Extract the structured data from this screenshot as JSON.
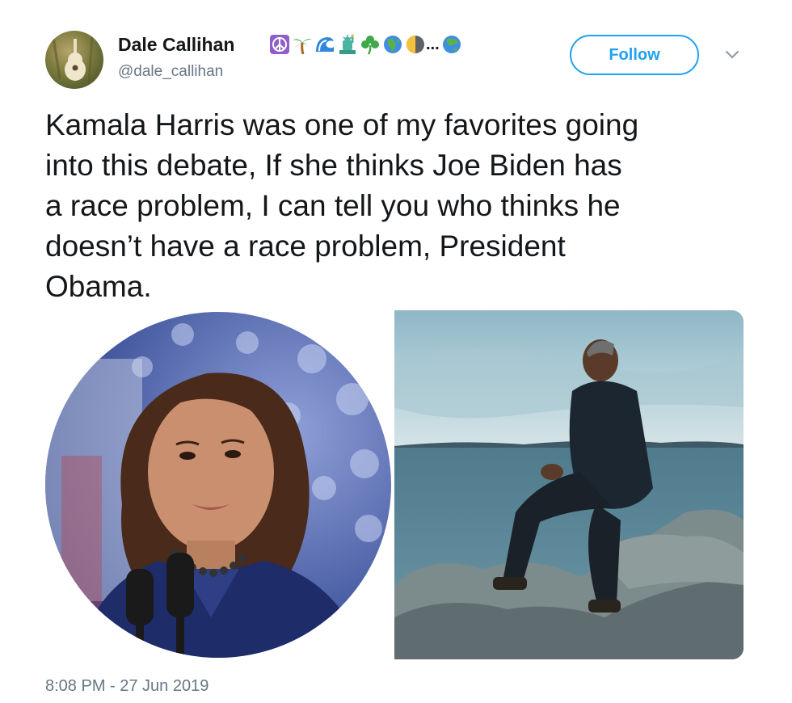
{
  "author": {
    "display_name": "Dale Callihan",
    "handle": "@dale_callihan",
    "name_emojis": [
      "peace-symbol",
      "palm-tree",
      "wave",
      "statue-of-liberty",
      "shamrock",
      "globe-africa",
      "last-quarter-moon",
      "globe-asia"
    ],
    "emoji_overflow": "..."
  },
  "follow_button": {
    "label": "Follow"
  },
  "tweet": {
    "text": "Kamala Harris was one of my favorites going\ninto this debate, If she thinks Joe Biden has\na race problem, I can tell you who thinks he\ndoesn’t have a race problem, President\nObama.",
    "timestamp": "8:08 PM - 27 Jun 2019"
  },
  "media": [
    {
      "name": "portrait-photo-circle",
      "icon": "photo"
    },
    {
      "name": "seaside-photo",
      "icon": "photo"
    }
  ],
  "colors": {
    "link_blue": "#1da1f2",
    "text": "#14171a",
    "secondary": "#657786"
  }
}
